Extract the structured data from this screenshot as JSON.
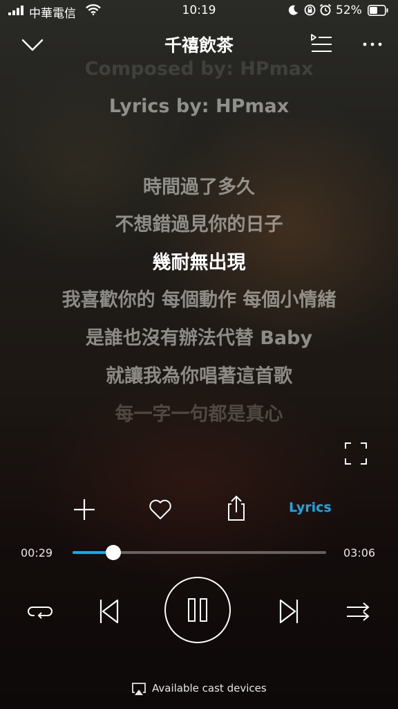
{
  "status_bar": {
    "carrier": "中華電信",
    "time": "10:19",
    "battery": "52%",
    "battery_level": 0.52,
    "icons": [
      "signal-icon",
      "wifi-icon",
      "moon-icon",
      "rotation-lock-icon",
      "alarm-icon",
      "battery-icon"
    ]
  },
  "header": {
    "title": "千禧飲茶",
    "icons": [
      "chevron-down-icon",
      "playlist-icon",
      "more-icon"
    ]
  },
  "lyrics": {
    "lines": [
      "Composed by: HPmax",
      "Lyrics by: HPmax",
      "時間過了多久",
      "不想錯過見你的日子",
      "幾耐無出現",
      "我喜歡你的 每個動作 每個小情緒",
      "是誰也沒有辦法代替 Baby",
      "就讓我為你唱著這首歌",
      "每一字一句都是真心"
    ],
    "current_index": 4
  },
  "actions": {
    "lyrics_label": "Lyrics",
    "icons": [
      "plus-icon",
      "heart-icon",
      "share-icon",
      "fullscreen-icon"
    ]
  },
  "progress": {
    "elapsed": "00:29",
    "duration": "03:06",
    "fraction": 0.16
  },
  "controls": {
    "icons": [
      "repeat-icon",
      "previous-icon",
      "pause-icon",
      "next-icon",
      "shuffle-icon"
    ]
  },
  "cast": {
    "label": "Available cast devices",
    "icon": "airplay-icon"
  },
  "colors": {
    "accent": "#1ea7e0",
    "text": "#ffffff"
  }
}
